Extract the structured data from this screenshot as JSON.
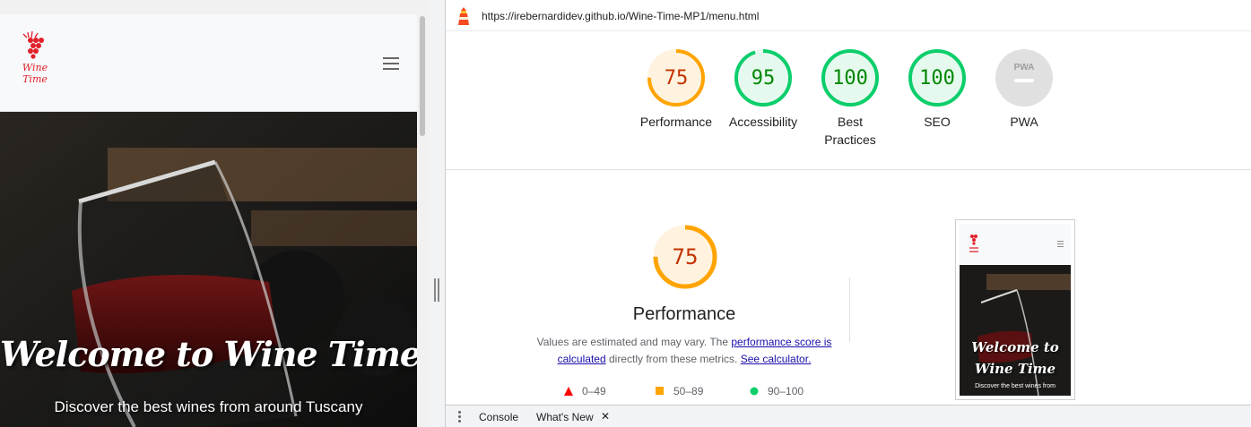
{
  "site": {
    "logo_text": "Wine Time",
    "hero_title": "Welcome to Wine Time",
    "hero_subtitle": "Discover the best wines from around Tuscany",
    "menu_icon": "hamburger-icon"
  },
  "report": {
    "url": "https://irebernardidev.github.io/Wine-Time-MP1/menu.html",
    "gauges": [
      {
        "label": "Performance",
        "score": "75",
        "value": 0.75,
        "status": "average"
      },
      {
        "label": "Accessibility",
        "score": "95",
        "value": 0.95,
        "status": "pass"
      },
      {
        "label": "Best Practices",
        "score": "100",
        "value": 1.0,
        "status": "pass"
      },
      {
        "label": "SEO",
        "score": "100",
        "value": 1.0,
        "status": "pass"
      },
      {
        "label": "PWA",
        "score": "PWA",
        "value": null,
        "status": "na"
      }
    ],
    "performance": {
      "score": "75",
      "value": 0.75,
      "title": "Performance",
      "desc_prefix": "Values are estimated and may vary. The ",
      "desc_link1": "performance score is calculated",
      "desc_middle": " directly from these metrics. ",
      "desc_link2": "See calculator.",
      "legend": [
        "0–49",
        "50–89",
        "90–100"
      ]
    },
    "thumbnail": {
      "title": "Welcome to Wine Time",
      "subtitle": "Discover the best wines from"
    }
  },
  "drawer": {
    "tabs": [
      "Console",
      "What's New"
    ],
    "close_glyph": "✕"
  },
  "colors": {
    "average": "#ffa400",
    "average_bg": "#fff3e0",
    "average_text": "#c33300",
    "pass": "#0cce6b",
    "pass_bg": "#e6f9ef",
    "pass_text": "#008800",
    "fail": "#ff0000",
    "na": "#e0e0e0"
  }
}
